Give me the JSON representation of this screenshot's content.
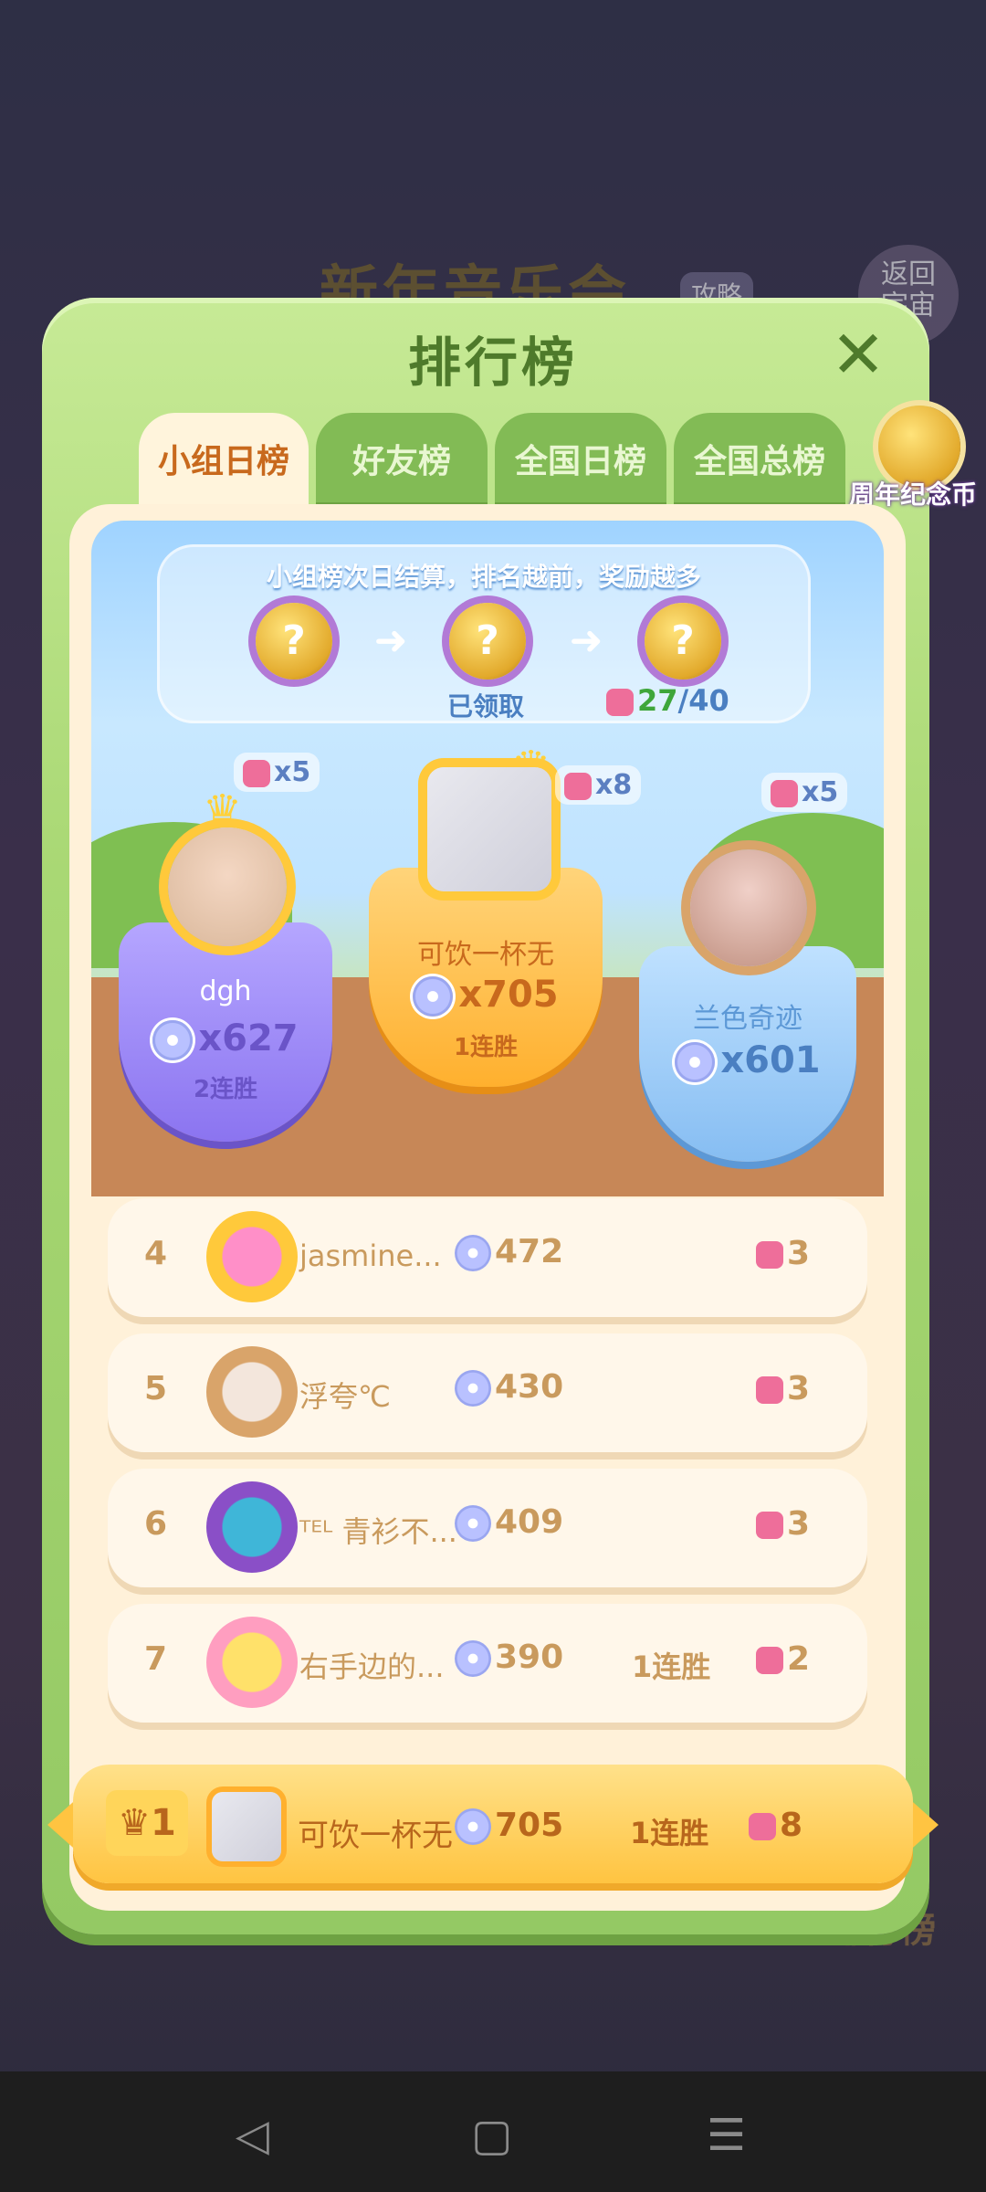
{
  "background": {
    "event_title": "新年音乐会",
    "guide_badge": "攻略",
    "back_button": "返回\n宇宙",
    "bottom_label": "排行榜"
  },
  "modal": {
    "title": "排行榜",
    "close_icon": "close-icon"
  },
  "tabs": [
    {
      "label": "小组日榜",
      "active": true
    },
    {
      "label": "好友榜",
      "active": false
    },
    {
      "label": "全国日榜",
      "active": false
    },
    {
      "label": "全国总榜",
      "active": false
    }
  ],
  "coin": {
    "label": "周年纪念币"
  },
  "info": {
    "text": "小组榜次日结算，排名越前，奖励越多",
    "claimed": "已领取",
    "progress_current": "27",
    "progress_total": "/40"
  },
  "podium": {
    "second": {
      "name": "dgh",
      "score": "x627",
      "streak": "2连胜",
      "pieces": "x5"
    },
    "first": {
      "name": "可饮一杯无",
      "score": "x705",
      "streak": "1连胜",
      "pieces": "x8"
    },
    "third": {
      "name": "兰色奇迹",
      "score": "x601",
      "streak": "",
      "pieces": "x5"
    }
  },
  "rows": [
    {
      "rank": "4",
      "name": "jasmine...",
      "score": "472",
      "streak": "",
      "pieces": "3"
    },
    {
      "rank": "5",
      "name": "浮夸℃",
      "score": "430",
      "streak": "",
      "pieces": "3"
    },
    {
      "rank": "6",
      "name": "ᵀᴱᴸ 青衫不...",
      "score": "409",
      "streak": "",
      "pieces": "3"
    },
    {
      "rank": "7",
      "name": "右手边的...",
      "score": "390",
      "streak": "1连胜",
      "pieces": "2"
    }
  ],
  "my_entry": {
    "rank": "1",
    "name": "可饮一杯无",
    "score": "705",
    "streak": "1连胜",
    "pieces": "8"
  },
  "nav": {
    "back": "◁",
    "home": "▢",
    "menu": "☰"
  }
}
